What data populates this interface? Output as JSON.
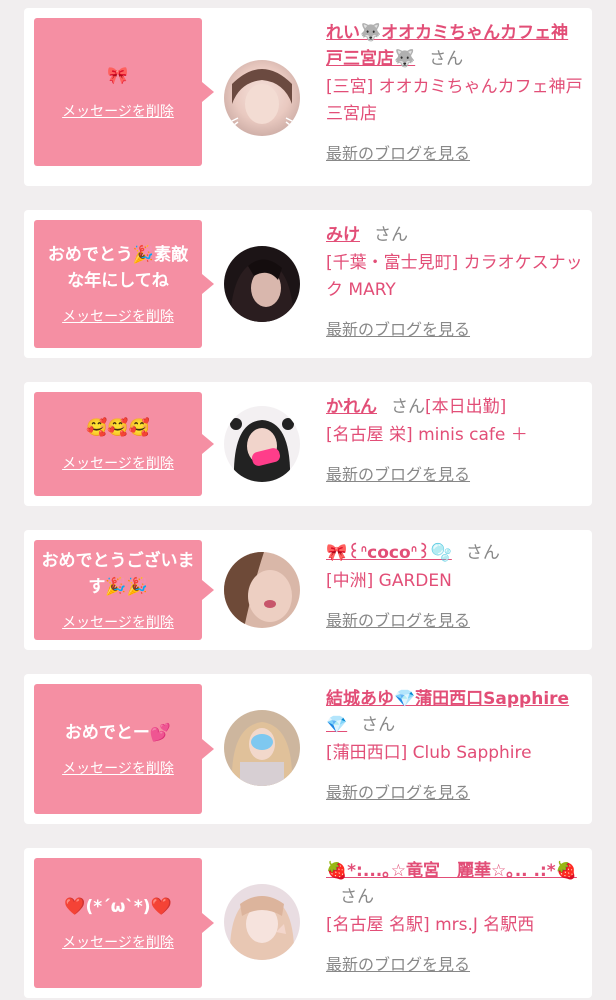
{
  "colors": {
    "background": "#f1eeef",
    "card": "#ffffff",
    "bubble": "#f58fa3",
    "accent": "#e24e77",
    "muted": "#888888"
  },
  "messages": [
    {
      "message": "🎀",
      "delete_label": "メッセージを削除",
      "name": "れい🐺オオカミちゃんカフェ神戸三宮店🐺",
      "honorific": "さん",
      "status": "",
      "shop": "[三宮] オオカミちゃんカフェ神戸三宮店",
      "blog_link": "最新のブログを見る"
    },
    {
      "message": "おめでとう🎉素敵な年にしてね",
      "delete_label": "メッセージを削除",
      "name": "みけ",
      "honorific": "さん",
      "status": "",
      "shop": "[千葉・富士見町] カラオケスナック MARY",
      "blog_link": "最新のブログを見る"
    },
    {
      "message": "🥰🥰🥰",
      "delete_label": "メッセージを削除",
      "name": "かれん",
      "honorific": "さん",
      "status": "[本日出勤]",
      "shop": "[名古屋 栄] minis cafe ＋",
      "blog_link": "最新のブログを見る"
    },
    {
      "message": "おめでとうございます🎉🎉",
      "delete_label": "メッセージを削除",
      "name": "🎀꒰ᐢcocoᐢ꒱🫧",
      "honorific": "さん",
      "status": "",
      "shop": "[中洲] GARDEN",
      "blog_link": "最新のブログを見る"
    },
    {
      "message": "おめでとー💕",
      "delete_label": "メッセージを削除",
      "name": "結城あゆ💎蒲田西口Sapphire💎",
      "honorific": "さん",
      "status": "",
      "shop": "[蒲田西口] Club Sapphire",
      "blog_link": "最新のブログを見る"
    },
    {
      "message": "❤️(*´ω`*)❤️",
      "delete_label": "メッセージを削除",
      "name": "🍓*:...｡☆竜宮　麗華☆｡.. .:*🍓",
      "honorific": "さん",
      "status": "",
      "shop": "[名古屋 名駅] mrs.J 名駅西",
      "blog_link": "最新のブログを見る"
    }
  ]
}
